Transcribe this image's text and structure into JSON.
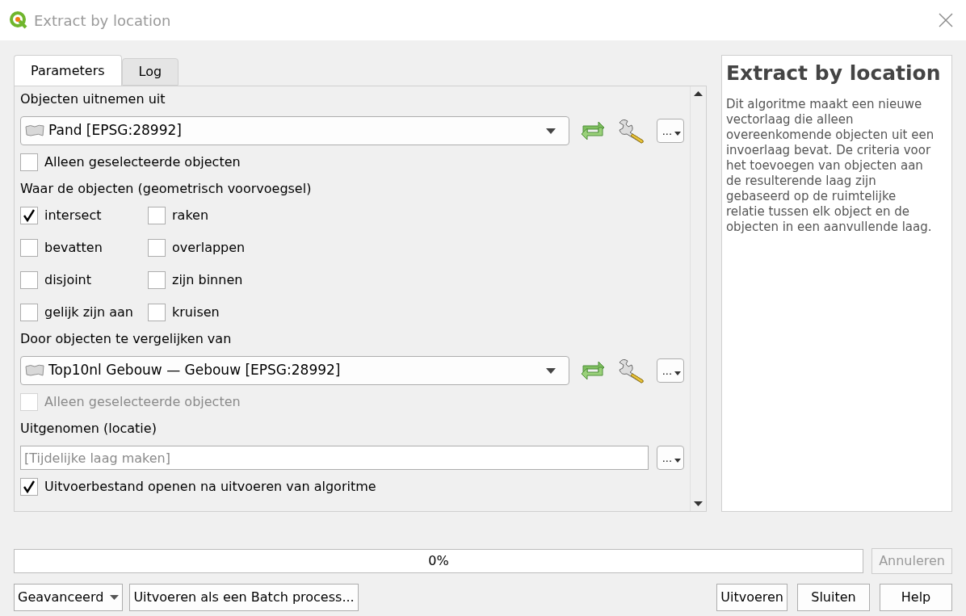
{
  "window": {
    "title": "Extract by location"
  },
  "tabs": [
    {
      "label": "Parameters",
      "selected": true
    },
    {
      "label": "Log",
      "selected": false
    }
  ],
  "parameters": {
    "input_label": "Objecten uitnemen uit",
    "input_layer": {
      "value": "Pand [EPSG:28992]",
      "more": "..."
    },
    "input_selected_only": {
      "label": "Alleen geselecteerde objecten",
      "checked": false,
      "disabled": false
    },
    "predicate_label": "Waar de objecten (geometrisch voorvoegsel)",
    "predicates": [
      {
        "label": "intersect",
        "checked": true
      },
      {
        "label": "raken",
        "checked": false
      },
      {
        "label": "bevatten",
        "checked": false
      },
      {
        "label": "overlappen",
        "checked": false
      },
      {
        "label": "disjoint",
        "checked": false
      },
      {
        "label": "zijn binnen",
        "checked": false
      },
      {
        "label": "gelijk zijn aan",
        "checked": false
      },
      {
        "label": "kruisen",
        "checked": false
      }
    ],
    "compare_label": "Door objecten te vergelijken van",
    "compare_layer": {
      "value": "Top10nl Gebouw — Gebouw [EPSG:28992]",
      "more": "..."
    },
    "compare_selected_only": {
      "label": "Alleen geselecteerde objecten",
      "checked": false,
      "disabled": true
    },
    "output_label": "Uitgenomen (locatie)",
    "output": {
      "placeholder": "[Tijdelijke laag maken]",
      "more": "..."
    },
    "open_output": {
      "label": "Uitvoerbestand openen na uitvoeren van algoritme",
      "checked": true,
      "disabled": false
    }
  },
  "help": {
    "title": "Extract by location",
    "text": "Dit algoritme maakt een nieuwe vectorlaag die alleen overeenkomende objecten uit een invoerlaag bevat. De criteria voor het toevoegen van objecten aan de resulterende laag zijn gebaseerd op de ruimtelijke relatie tussen elk object en de objecten in een aanvullende laag."
  },
  "progress": {
    "level": 0,
    "reading": "0%"
  },
  "buttons": {
    "cancel": {
      "label": "Annuleren",
      "disabled": true
    },
    "advanced": "Geavanceerd",
    "batch": "Uitvoeren als een Batch process...",
    "run": "Uitvoeren",
    "close": "Sluiten",
    "help": "Help"
  }
}
